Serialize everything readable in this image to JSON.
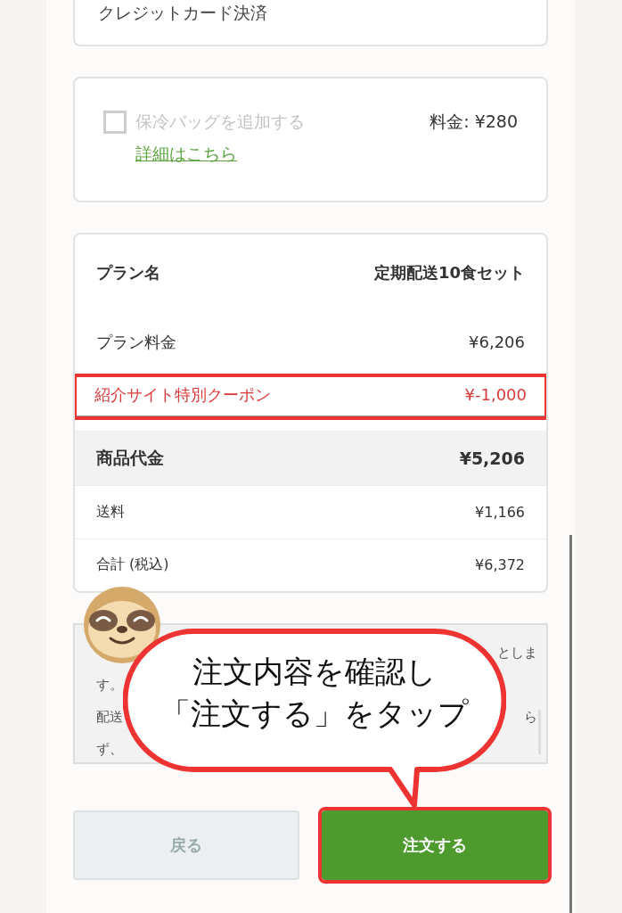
{
  "payment_card": {
    "value": "クレジットカード決済"
  },
  "cooler_bag": {
    "label": "保冷バッグを追加する",
    "checked": false,
    "disabled": true,
    "link": "詳細はこちら",
    "price": "料金: ¥280"
  },
  "summary": {
    "rows": [
      {
        "kind": "header",
        "label": "プラン名",
        "value": "定期配送10食セット",
        "highlighted": false
      },
      {
        "kind": "normal",
        "label": "プラン料金",
        "value": "¥6,206",
        "highlighted": false
      },
      {
        "kind": "discount",
        "label": "紹介サイト特別クーポン",
        "value": "¥-1,000",
        "highlighted": true
      },
      {
        "kind": "subtotal",
        "label": "商品代金",
        "value": "¥5,206",
        "highlighted": false
      },
      {
        "kind": "small",
        "label": "送料",
        "value": "¥1,166",
        "highlighted": false
      },
      {
        "kind": "small",
        "label": "合計 (税込)",
        "value": "¥6,372",
        "highlighted": false
      }
    ]
  },
  "terms": {
    "lines": [
      {
        "right": "としま"
      },
      {
        "left": "す。"
      },
      {
        "left": "配送",
        "right": "ら"
      },
      {
        "left": "ず、"
      }
    ]
  },
  "callout": {
    "lines": [
      "注文内容を確認し",
      "「注文する」をタップ"
    ]
  },
  "buttons": [
    {
      "kind": "back",
      "label": "戻る",
      "highlighted": false
    },
    {
      "kind": "primary",
      "label": "注文する",
      "highlighted": true
    }
  ]
}
